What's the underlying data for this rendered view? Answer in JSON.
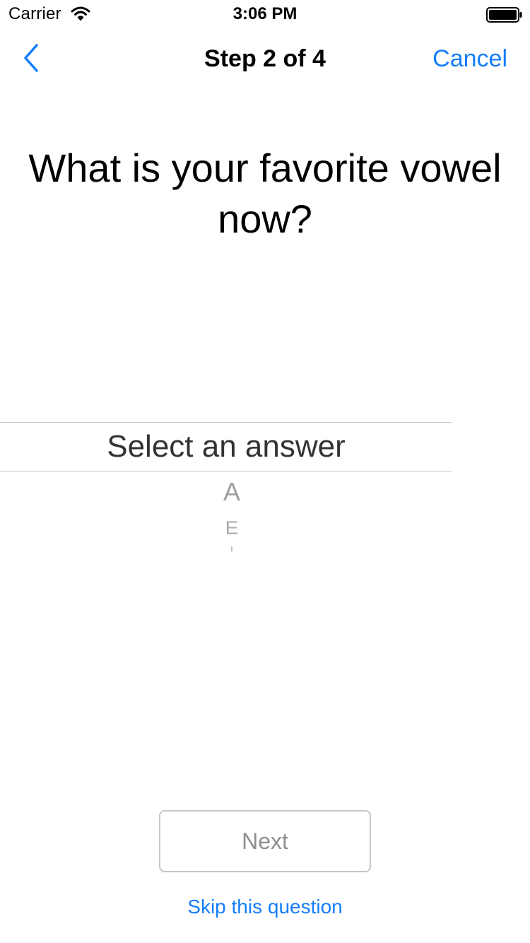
{
  "status_bar": {
    "carrier": "Carrier",
    "time": "3:06 PM",
    "wifi_icon": "wifi-icon",
    "battery_icon": "battery-icon"
  },
  "nav": {
    "back_icon": "chevron-left-icon",
    "title": "Step 2 of 4",
    "cancel_label": "Cancel"
  },
  "question": {
    "text": "What is your favorite vowel now?"
  },
  "picker": {
    "selected": "Select an answer",
    "options": [
      "A",
      "E",
      "I"
    ]
  },
  "actions": {
    "next_label": "Next",
    "skip_label": "Skip this question"
  },
  "colors": {
    "accent": "#147efb",
    "disabled_text": "#8e8e93",
    "separator": "#c8c8cc"
  }
}
